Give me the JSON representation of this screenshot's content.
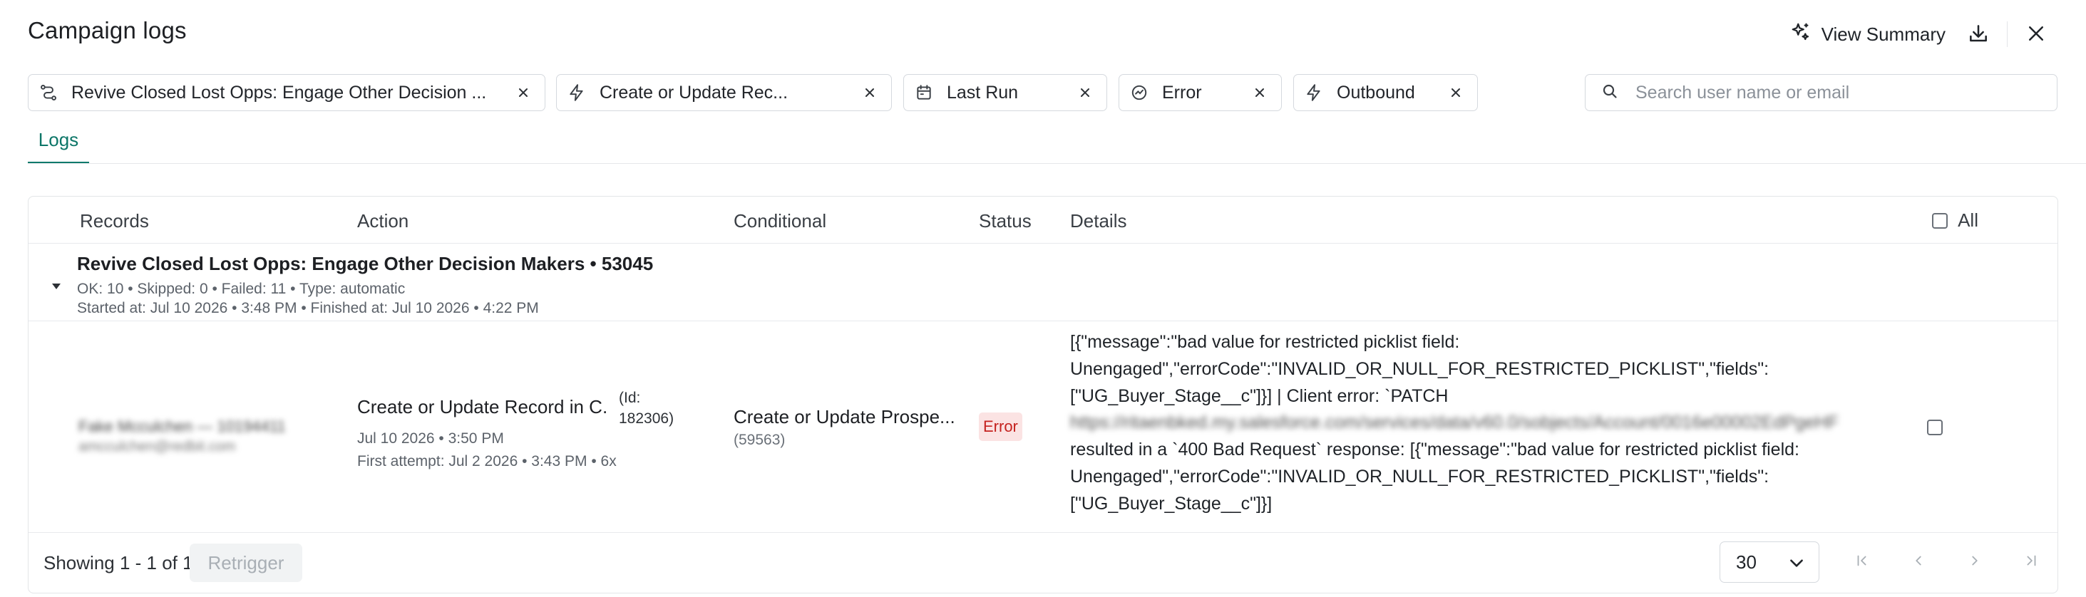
{
  "header": {
    "title": "Campaign logs",
    "view_summary_label": "View Summary"
  },
  "filters": [
    {
      "label": "Revive Closed Lost Opps: Engage Other Decision ...",
      "icon": "workflow-icon"
    },
    {
      "label": "Create or Update Rec...",
      "icon": "lightning-icon"
    },
    {
      "label": "Last Run",
      "icon": "calendar-icon"
    },
    {
      "label": "Error",
      "icon": "error-status-icon"
    },
    {
      "label": "Outbound",
      "icon": "lightning-icon"
    }
  ],
  "search": {
    "placeholder": "Search user name or email",
    "value": ""
  },
  "tabs": [
    {
      "label": "Logs",
      "active": true
    }
  ],
  "table": {
    "columns": {
      "records": "Records",
      "action": "Action",
      "conditional": "Conditional",
      "status": "Status",
      "details": "Details",
      "all": "All"
    },
    "group": {
      "title": "Revive Closed Lost Opps: Engage Other Decision Makers • 53045",
      "stats": "OK: 10 • Skipped: 0 • Failed: 11 • Type: automatic",
      "timing": "Started at: Jul 10 2026 • 3:48 PM • Finished at: Jul 10 2026 • 4:22 PM"
    },
    "row": {
      "record_name": "Fake Mcculchen — 10194411",
      "record_email": "amcculchen@redbit.com",
      "action_title": "Create or Update Record in C...",
      "action_id": "(Id: 182306)",
      "action_date": "Jul 10 2026 • 3:50 PM",
      "action_first_attempt": "First attempt: Jul 2 2026 • 3:43 PM • 6x",
      "conditional_title": "Create or Update Prospe...",
      "conditional_id": "(59563)",
      "status": "Error",
      "details": {
        "line1": "[{\"message\":\"bad value for restricted picklist field:",
        "line2": "Unengaged\",\"errorCode\":\"INVALID_OR_NULL_FOR_RESTRICTED_PICKLIST\",\"fields\":",
        "line3": "[\"UG_Buyer_Stage__c\"]}] | Client error: `PATCH",
        "line4_url": "https://ritaenbked.my.salesforce.com/services/data/v60.0/sobjects/Account/0016e00002EdPgeHF",
        "line5": "resulted in a `400 Bad Request` response: [{\"message\":\"bad value for restricted picklist field:",
        "line6": "Unengaged\",\"errorCode\":\"INVALID_OR_NULL_FOR_RESTRICTED_PICKLIST\",\"fields\":",
        "line7": "[\"UG_Buyer_Stage__c\"]}]"
      }
    }
  },
  "footer": {
    "showing": "Showing 1 - 1 of 1",
    "retrigger_label": "Retrigger",
    "page_size": "30"
  },
  "colors": {
    "accent": "#0f7a6b",
    "error_bg": "#fbe3e3",
    "error_text": "#c5221f"
  }
}
